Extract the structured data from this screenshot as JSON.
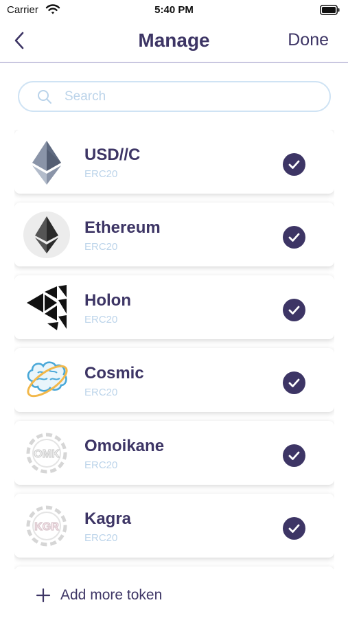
{
  "status": {
    "carrier": "Carrier",
    "time": "5:40 PM"
  },
  "nav": {
    "title": "Manage",
    "done_label": "Done"
  },
  "search": {
    "placeholder": "Search",
    "value": ""
  },
  "tokens": [
    {
      "name": "USD//C",
      "standard": "ERC20",
      "icon": "ethereum-diamond-icon",
      "enabled": true
    },
    {
      "name": "Ethereum",
      "standard": "ERC20",
      "icon": "ethereum-logo-icon",
      "enabled": true
    },
    {
      "name": "Holon",
      "standard": "ERC20",
      "icon": "holon-triangles-icon",
      "enabled": true
    },
    {
      "name": "Cosmic",
      "standard": "ERC20",
      "icon": "cosmic-brain-icon",
      "enabled": true
    },
    {
      "name": "Omoikane",
      "standard": "ERC20",
      "icon": "omoikane-gear-logo",
      "logo_text": "OMK",
      "enabled": true
    },
    {
      "name": "Kagra",
      "standard": "ERC20",
      "icon": "kagra-gear-logo",
      "logo_text": "KGR",
      "enabled": true
    }
  ],
  "footer": {
    "add_label": "Add more token"
  },
  "colors": {
    "primary": "#3d3565",
    "secondary_text": "#bcd4ea",
    "search_border": "#cfe3f4",
    "cosmic_blue": "#4aa8d8",
    "cosmic_orange": "#f2b84b"
  }
}
